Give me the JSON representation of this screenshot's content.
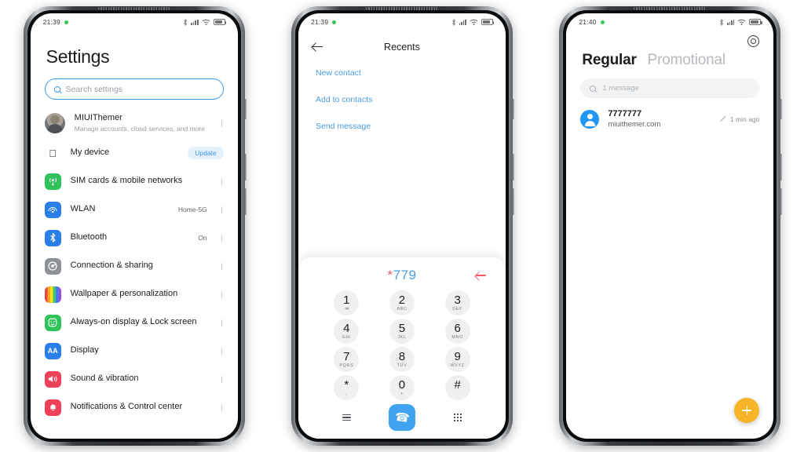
{
  "phone1": {
    "status": {
      "time": "21:39",
      "dot": "recording-dot",
      "icons": [
        "bluetooth-icon",
        "signal-icon",
        "wifi-icon",
        "battery-icon"
      ]
    },
    "title": "Settings",
    "search": {
      "placeholder": "Search settings",
      "icon": "search-icon"
    },
    "account": {
      "name": "MIUIThemer",
      "subtitle": "Manage accounts, cloud services, and more",
      "avatar": "user-avatar"
    },
    "items": [
      {
        "label": "My device",
        "icon": "apple-icon",
        "icon_color": "#ffffff",
        "glyph": "",
        "badge": "Update",
        "value": "",
        "chevron": false
      },
      {
        "label": "SIM cards & mobile networks",
        "icon": "sim-signal-icon",
        "icon_color": "#30c25b",
        "glyph": "",
        "badge": "",
        "value": "",
        "chevron": true
      },
      {
        "label": "WLAN",
        "icon": "wifi-icon",
        "icon_color": "#2b7fe8",
        "glyph": "",
        "badge": "",
        "value": "Home-5G",
        "chevron": true
      },
      {
        "label": "Bluetooth",
        "icon": "bluetooth-icon",
        "icon_color": "#2b7fe8",
        "glyph": "",
        "badge": "",
        "value": "On",
        "chevron": true
      },
      {
        "label": "Connection & sharing",
        "icon": "connection-sharing-icon",
        "icon_color": "#8e9296",
        "glyph": "",
        "badge": "",
        "value": "",
        "chevron": true
      },
      {
        "label": "Wallpaper & personalization",
        "icon": "wallpaper-icon",
        "icon_color": "#cccccc",
        "glyph": "",
        "badge": "",
        "value": "",
        "chevron": true
      },
      {
        "label": "Always-on display & Lock screen",
        "icon": "aod-lockscreen-icon",
        "icon_color": "#30c25b",
        "glyph": "",
        "badge": "",
        "value": "",
        "chevron": true
      },
      {
        "label": "Display",
        "icon": "display-icon",
        "icon_color": "#2b7fe8",
        "glyph": "AA",
        "badge": "",
        "value": "",
        "chevron": true
      },
      {
        "label": "Sound & vibration",
        "icon": "sound-vibration-icon",
        "icon_color": "#f0415a",
        "glyph": "",
        "badge": "",
        "value": "",
        "chevron": true
      },
      {
        "label": "Notifications & Control center",
        "icon": "notifications-icon",
        "icon_color": "#f0415a",
        "glyph": "",
        "badge": "",
        "value": "",
        "chevron": true
      }
    ]
  },
  "phone2": {
    "status": {
      "time": "21:39",
      "dot": "recording-dot"
    },
    "header": {
      "back": "back-arrow-icon",
      "title": "Recents"
    },
    "links": [
      "New contact",
      "Add to contacts",
      "Send message"
    ],
    "dialer": {
      "entered_prefix": "*",
      "entered_number": "779",
      "backspace": "backspace-icon",
      "keys": [
        {
          "digit": "1",
          "sub": "",
          "vm": "∞"
        },
        {
          "digit": "2",
          "sub": "ABC",
          "vm": ""
        },
        {
          "digit": "3",
          "sub": "DEF",
          "vm": ""
        },
        {
          "digit": "4",
          "sub": "GHI",
          "vm": ""
        },
        {
          "digit": "5",
          "sub": "JKL",
          "vm": ""
        },
        {
          "digit": "6",
          "sub": "MNO",
          "vm": ""
        },
        {
          "digit": "7",
          "sub": "PQRS",
          "vm": ""
        },
        {
          "digit": "8",
          "sub": "TUV",
          "vm": ""
        },
        {
          "digit": "9",
          "sub": "WXYZ",
          "vm": ""
        },
        {
          "digit": "*",
          "sub": ",",
          "vm": ""
        },
        {
          "digit": "0",
          "sub": "+",
          "vm": ""
        },
        {
          "digit": "#",
          "sub": "",
          "vm": ""
        }
      ],
      "actions": {
        "menu": "menu-icon",
        "call": "call-icon",
        "keypad": "keypad-icon"
      },
      "call_color": "#40a3ef",
      "number_color": "#4a9de0",
      "star_color": "#e4616f"
    }
  },
  "phone3": {
    "status": {
      "time": "21:40",
      "dot": "recording-dot"
    },
    "settings_icon": "gear-icon",
    "tabs": [
      {
        "label": "Regular",
        "active": true
      },
      {
        "label": "Promotional",
        "active": false
      }
    ],
    "search": {
      "placeholder": "1 message",
      "icon": "search-icon"
    },
    "messages": [
      {
        "name": "7777777",
        "preview": "miuithemer.com",
        "time": "1 min ago",
        "status_icon": "pencil-icon"
      }
    ],
    "fab": {
      "icon": "plus-icon",
      "color": "#f6b426"
    }
  }
}
